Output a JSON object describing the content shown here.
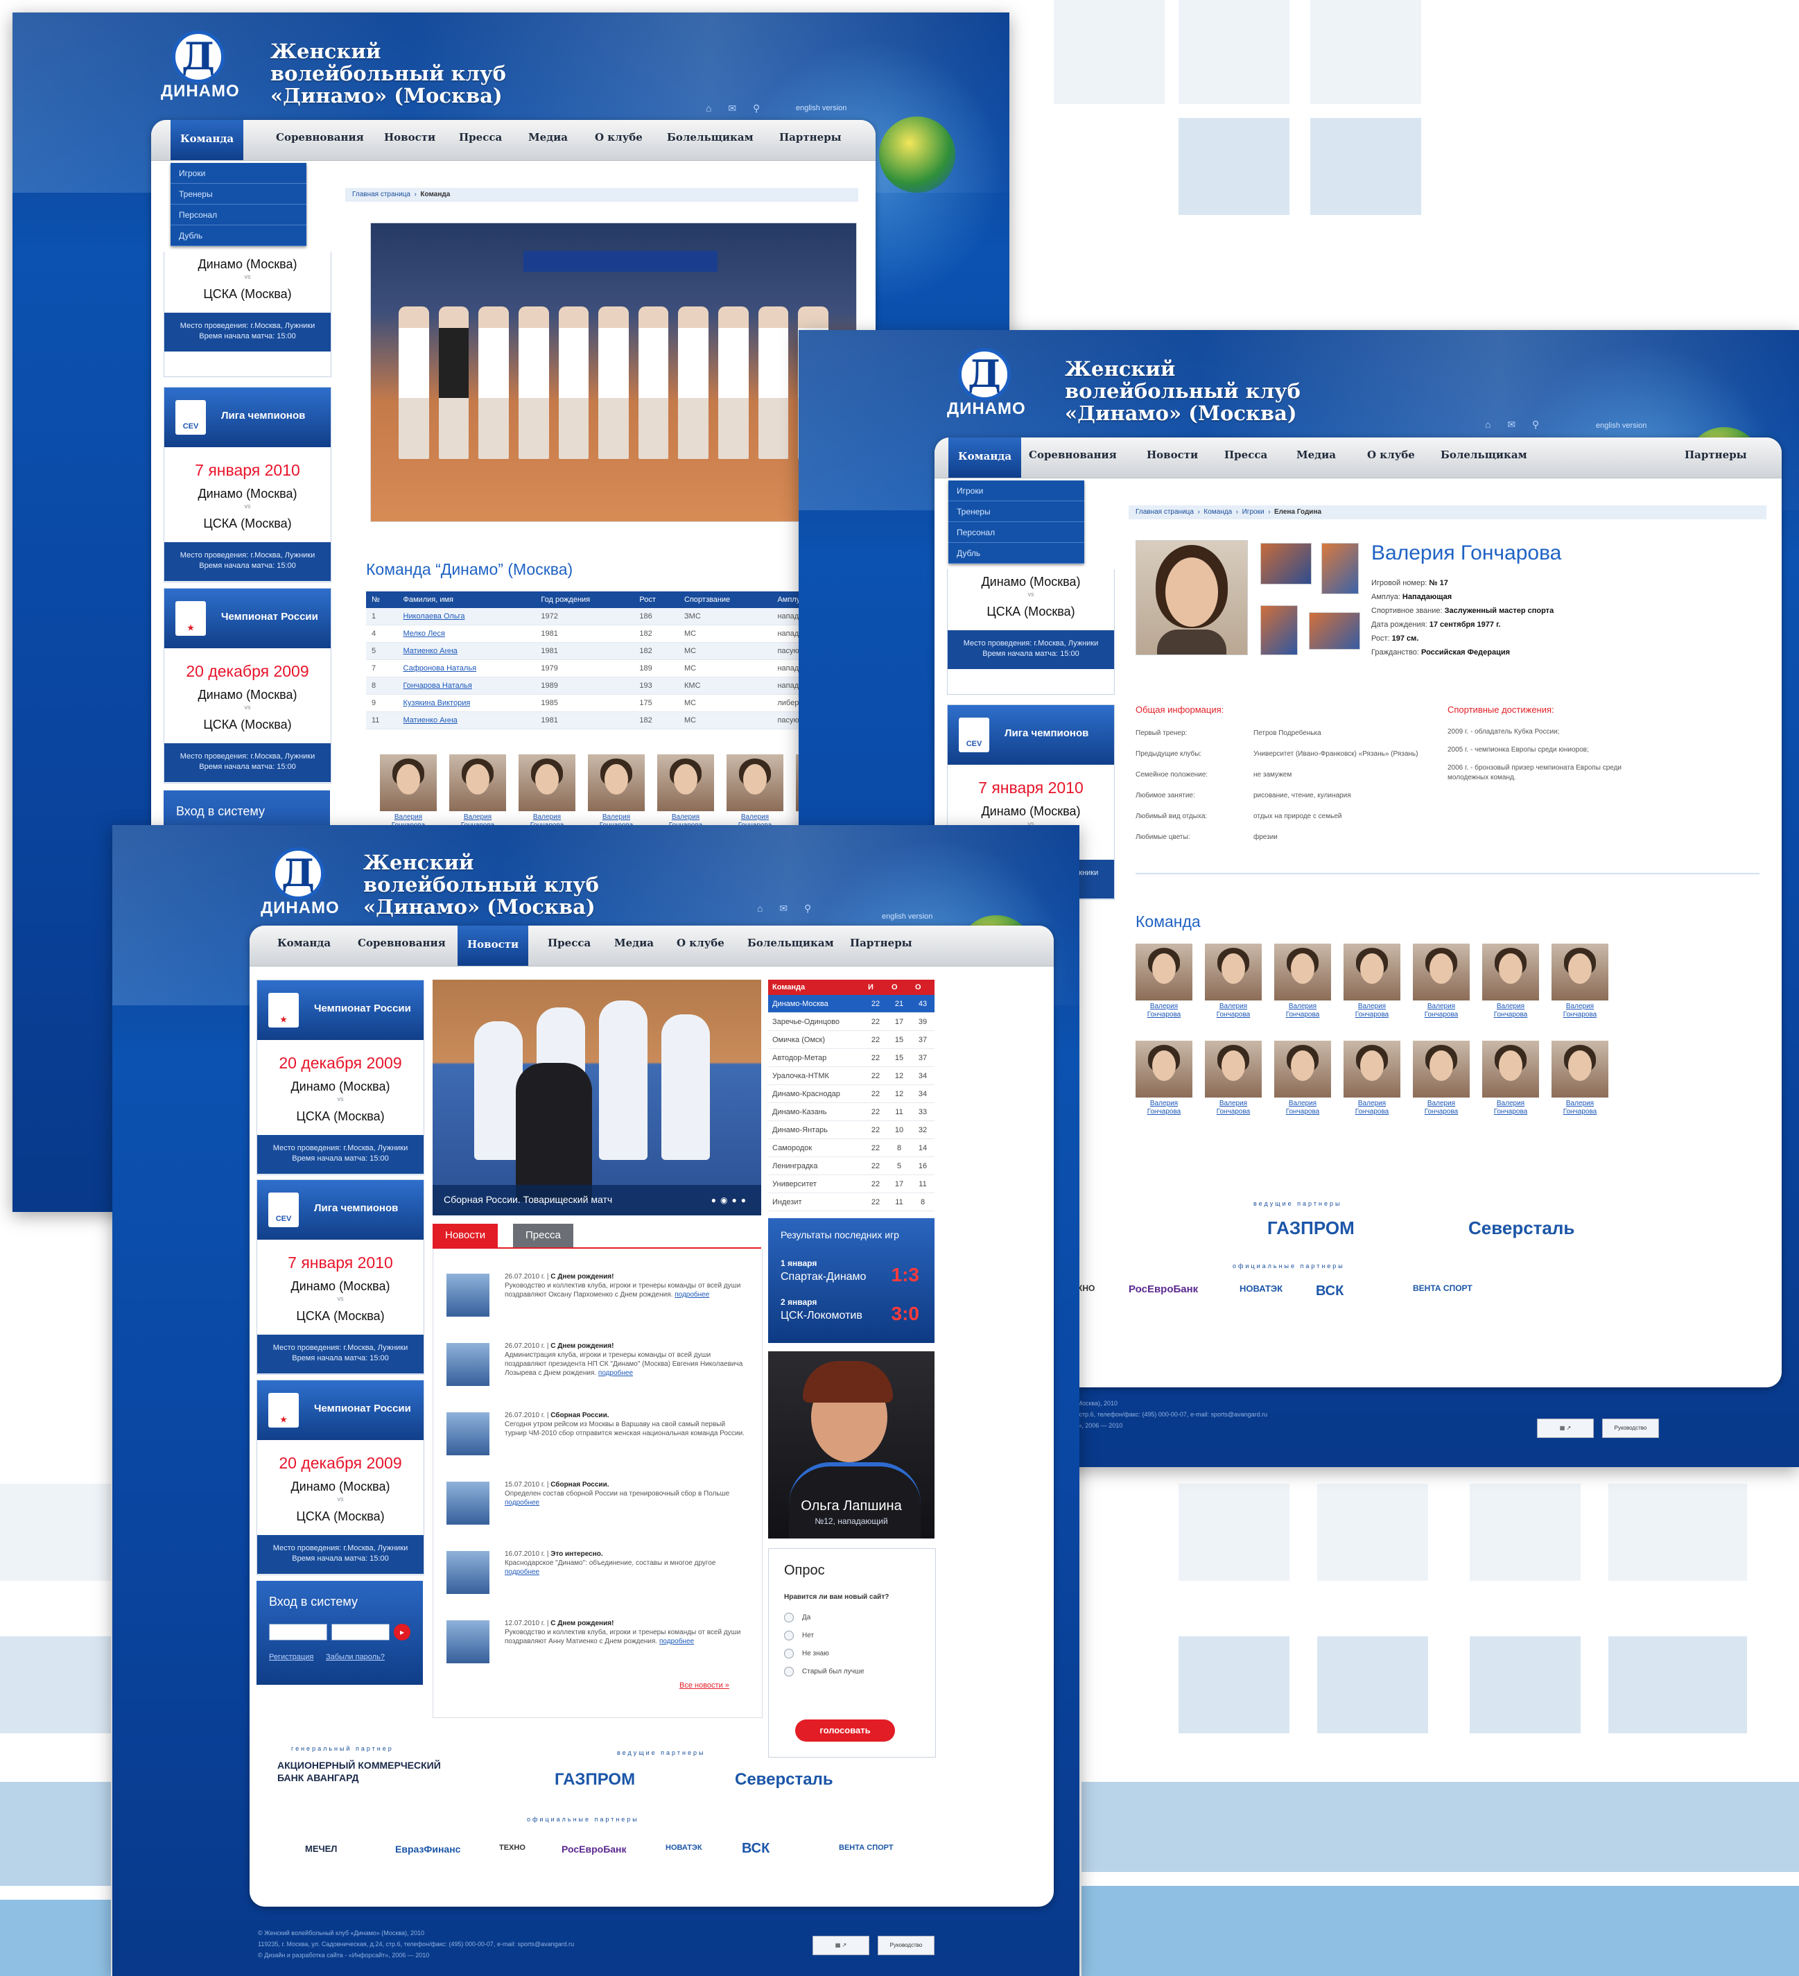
{
  "club": {
    "logo_word": "ДИНАМО",
    "logo_letter": "Д",
    "title_line1": "Женский",
    "title_line2": "волейбольный клуб",
    "title_line3": "«Динамо» (Москва)",
    "english_link": "english version"
  },
  "nav": [
    "Команда",
    "Соревнования",
    "Новости",
    "Пресса",
    "Медиа",
    "О клубе",
    "Болельщикам",
    "Партнеры"
  ],
  "dropdown": [
    "Игроки",
    "Тренеры",
    "Персонал",
    "Дубль"
  ],
  "matches": [
    {
      "league": "Чемпионат России",
      "date": "20 декабря 2009",
      "home": "Динамо (Москва)",
      "vs": "vs",
      "away": "ЦСКА (Москва)",
      "venue": "Место проведения: г.Москва, Лужники",
      "time": "Время начала матча: 15:00"
    },
    {
      "league": "Лига чемпионов",
      "date": "7 января 2010",
      "home": "Динамо (Москва)",
      "vs": "vs",
      "away": "ЦСКА (Москва)",
      "venue": "Место проведения: г.Москва, Лужники",
      "time": "Время начала матча: 15:00"
    }
  ],
  "cev": "CEV",
  "login": {
    "title": "Вход в систему",
    "register": "Регистрация",
    "forgot": "Забыли пароль?"
  },
  "page1": {
    "breadcrumb": [
      "Главная страница",
      "Команда"
    ],
    "team_title": "Команда “Динамо” (Москва)",
    "roster_headers": [
      "№",
      "Фамилия, имя",
      "Год рождения",
      "Рост",
      "Спортзвание",
      "Амплуа"
    ],
    "roster": [
      [
        "1",
        "Николаева Ольга",
        "1972",
        "186",
        "ЗМС",
        "нападающая"
      ],
      [
        "4",
        "Мелко Леся",
        "1981",
        "182",
        "МС",
        "нападающая"
      ],
      [
        "5",
        "Матиенко Анна",
        "1981",
        "182",
        "МС",
        "пасующая"
      ],
      [
        "7",
        "Сафронова Наталья",
        "1979",
        "189",
        "МС",
        "нападающая"
      ],
      [
        "8",
        "Гончарова Наталья",
        "1989",
        "193",
        "КМС",
        "нападающая"
      ],
      [
        "9",
        "Кузякина Виктория",
        "1985",
        "175",
        "МС",
        "либеро"
      ],
      [
        "11",
        "Матиенко Анна",
        "1981",
        "182",
        "МС",
        "пасующая"
      ]
    ],
    "thumb_label": "Валерия Гончарова"
  },
  "page2": {
    "breadcrumb": [
      "Главная страница",
      "Команда",
      "Игроки",
      "Елена Година"
    ],
    "player_name": "Валерия Гончарова",
    "facts": [
      {
        "k": "Игровой номер:",
        "v": "№ 17"
      },
      {
        "k": "Амплуа:",
        "v": "Нападающая"
      },
      {
        "k": "Спортивное звание:",
        "v": "Заслуженный мастер спорта"
      },
      {
        "k": "Дата рождения:",
        "v": "17 сентября 1977 г."
      },
      {
        "k": "Рост:",
        "v": "197 см."
      },
      {
        "k": "Гражданство:",
        "v": "Российская Федерация"
      }
    ],
    "general_title": "Общая информация:",
    "general": [
      {
        "k": "Первый тренер:",
        "v": "Петров Подребенька"
      },
      {
        "k": "Предыдущие клубы:",
        "v": "Университет (Ивано-Франковск) «Рязань» (Рязань)"
      },
      {
        "k": "Семейное положение:",
        "v": "не замужем"
      },
      {
        "k": "Любимое занятие:",
        "v": "рисование, чтение, кулинария"
      },
      {
        "k": "Любимый вид отдыха:",
        "v": "отдых на природе с семьей"
      },
      {
        "k": "Любимые цветы:",
        "v": "фрезии"
      }
    ],
    "ach_title": "Спортивные достижения:",
    "achievements": [
      "2009 г. - обладатель Кубка России;",
      "2005 г. - чемпионка Европы среди юниоров;",
      "2006 г. - бронзовый призер чемпионата Европы среди молодежных команд."
    ],
    "team_title": "Команда",
    "thumb_label": "Валерия Гончарова"
  },
  "page3": {
    "photo_caption": "Сборная России. Товарищеский матч",
    "standings_headers": [
      "Команда",
      "И",
      "О",
      "О"
    ],
    "standings": [
      [
        "Динамо-Москва",
        "22",
        "21",
        "43"
      ],
      [
        "Заречье-Одинцово",
        "22",
        "17",
        "39"
      ],
      [
        "Омичка (Омск)",
        "22",
        "15",
        "37"
      ],
      [
        "Автодор-Метар",
        "22",
        "15",
        "37"
      ],
      [
        "Уралочка-НТМК",
        "22",
        "12",
        "34"
      ],
      [
        "Динамо-Краснодар",
        "22",
        "12",
        "34"
      ],
      [
        "Динамо-Казань",
        "22",
        "11",
        "33"
      ],
      [
        "Динамо-Янтарь",
        "22",
        "10",
        "32"
      ],
      [
        "Самородок",
        "22",
        "8",
        "14"
      ],
      [
        "Ленинградка",
        "22",
        "5",
        "16"
      ],
      [
        "Университет",
        "22",
        "17",
        "11"
      ],
      [
        "Индезит",
        "22",
        "11",
        "8"
      ]
    ],
    "results_title": "Результаты последних игр",
    "results": [
      {
        "date": "1 января",
        "match": "Спартак-Динамо",
        "score": "1:3"
      },
      {
        "date": "2 января",
        "match": "ЦСК-Локомотив",
        "score": "3:0"
      }
    ],
    "tabs": [
      "Новости",
      "Пресса"
    ],
    "news": [
      {
        "date": "26.07.2010 г.",
        "title": "С Днем рождения!",
        "text": "Руководство и коллектив клуба, игроки и тренеры команды от всей души поздравляют Оксану Пархоменко с Днем рождения.",
        "more": "подробнее"
      },
      {
        "date": "26.07.2010 г.",
        "title": "С Днем рождения!",
        "text": "Администрация клуба, игроки и тренеры команды от всей души поздравляют президента НП СК \"Динамо\" (Москва) Евгения Николаевича Лозырева с Днем рождения.",
        "more": "подробнее"
      },
      {
        "date": "26.07.2010 г.",
        "title": "Сборная России.",
        "text": "Сегодня утром рейсом из Москвы в Варшаву на свой самый первый турнир ЧМ-2010 сбор отправится женская национальная команда России.",
        "more": ""
      },
      {
        "date": "15.07.2010 г.",
        "title": "Сборная России.",
        "text": "Определен состав сборной России на тренировочный сбор в Польше",
        "more": "подробнее"
      },
      {
        "date": "16.07.2010 г.",
        "title": "Это интересно.",
        "text": "Краснодарское \"Динамо\": объединение, составы и многое другое",
        "more": "подробнее"
      },
      {
        "date": "12.07.2010 г.",
        "title": "С Днем рождения!",
        "text": "Руководство и коллектив клуба, игроки и тренеры команды от всей души поздравляют Анну Матиенко с Днем рождения.",
        "more": "подробнее"
      }
    ],
    "all_news": "Все новости »",
    "featured_name": "Ольга Лапшина",
    "featured_role": "№12, нападающий",
    "poll": {
      "title": "Опрос",
      "question": "Нравится ли вам новый сайт?",
      "options": [
        "Да",
        "Нет",
        "Не знаю",
        "Старый был лучше"
      ],
      "vote": "голосовать"
    }
  },
  "partners": {
    "general_h": "генеральный партнер",
    "leading_h": "ведущие партнеры",
    "official_h": "официальные партнеры",
    "general": "АКЦИОНЕРНЫЙ КОММЕРЧЕСКИЙ БАНК АВАНГАРД",
    "leading": [
      "ГАЗПРОМ",
      "Северсталь"
    ],
    "official": [
      "МЕЧЕЛ",
      "ЕвразФинанс",
      "ТЕХНО",
      "РосЕвроБанк",
      "НОВАТЭК",
      "ВСК",
      "ВЕНТА СПОРТ"
    ]
  },
  "footer": {
    "line1": "© Женский волейбольный клуб «Динамо» (Москва), 2010",
    "line2": "119235, г. Москва, ул. Садовническая, д.24, стр.6, телефон/факс: (495) 000-00-07, e-mail: sports@avangard.ru",
    "line3": "© Дизайн и разработка сайта - «Инфорсайт», 2006 — 2010"
  },
  "colors": {
    "brand_blue": "#0c52b0",
    "accent_red": "#e21d25",
    "link_blue": "#1b57b9"
  }
}
